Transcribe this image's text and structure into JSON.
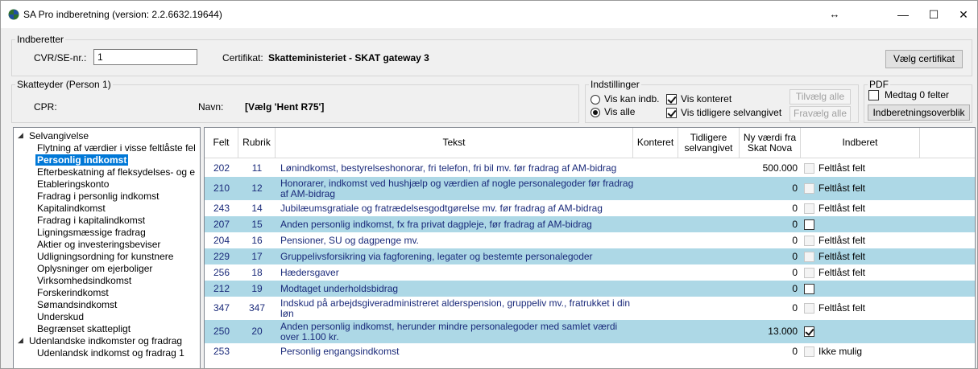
{
  "window": {
    "title": "SA Pro indberetning (version: 2.2.6632.19644)",
    "controls": {
      "resize": "↔",
      "minimize": "—",
      "maximize": "☐",
      "close": "✕"
    }
  },
  "indberetter": {
    "group_title": "Indberetter",
    "cvr_label": "CVR/SE-nr.:",
    "cvr_value": "1",
    "cert_label": "Certifikat:",
    "cert_value": "Skatteministeriet - SKAT gateway 3",
    "choose_cert_button": "Vælg certifikat"
  },
  "skatteyder": {
    "group_title": "Skatteyder (Person 1)",
    "cpr_label": "CPR:",
    "cpr_value": "",
    "navn_label": "Navn:",
    "navn_value": "[Vælg 'Hent R75']"
  },
  "indstillinger": {
    "group_title": "Indstillinger",
    "radio_vis_kan": "Vis kan indb.",
    "radio_vis_alle": "Vis alle",
    "cb_vis_konteret": "Vis konteret",
    "cb_vis_tidligere": "Vis tidligere selvangivet",
    "tilvaelg_alle": "Tilvælg alle",
    "fravaelg_alle": "Fravælg alle"
  },
  "pdf": {
    "group_title": "PDF",
    "medtag_label": "Medtag 0 felter",
    "overblik_button": "Indberetningsoverblik"
  },
  "tree": {
    "root1": "Selvangivelse",
    "items": [
      "Flytning af værdier i visse feltlåste fel",
      "Personlig indkomst",
      "Efterbeskatning af fleksydelses- og e",
      "Etableringskonto",
      "Fradrag i personlig indkomst",
      "Kapitalindkomst",
      "Fradrag i kapitalindkomst",
      "Ligningsmæssige fradrag",
      "Aktier og investeringsbeviser",
      "Udligningsordning for kunstnere",
      "Oplysninger om ejerboliger",
      "Virksomhedsindkomst",
      "Forskerindkomst",
      "Sømandsindkomst",
      "Underskud",
      "Begrænset skattepligt"
    ],
    "root2": "Udenlandske indkomster og fradrag",
    "root2_items": [
      "Udenlandsk indkomst og fradrag 1"
    ]
  },
  "grid": {
    "headers": {
      "felt": "Felt",
      "rubrik": "Rubrik",
      "tekst": "Tekst",
      "konteret": "Konteret",
      "tidligere": "Tidligere selvangivet",
      "ny_vaerdi": "Ny værdi fra Skat Nova",
      "indberet": "Indberet"
    },
    "rows": [
      {
        "felt": "202",
        "rubrik": "11",
        "tekst": "Lønindkomst, bestyrelseshonorar, fri telefon, fri bil mv. før fradrag af AM-bidrag",
        "ny": "500.000",
        "checked": false,
        "disabled": true,
        "label": "Feltlåst felt"
      },
      {
        "felt": "210",
        "rubrik": "12",
        "tekst": "Honorarer, indkomst ved hushjælp og værdien af nogle personalegoder før fradrag af AM-bidrag",
        "ny": "0",
        "checked": false,
        "disabled": true,
        "label": "Feltlåst felt"
      },
      {
        "felt": "243",
        "rubrik": "14",
        "tekst": "Jubilæumsgratiale og fratrædelsesgodtgørelse mv. før fradrag af AM-bidrag",
        "ny": "0",
        "checked": false,
        "disabled": true,
        "label": "Feltlåst felt"
      },
      {
        "felt": "207",
        "rubrik": "15",
        "tekst": "Anden personlig indkomst, fx fra privat dagpleje, før fradrag af AM-bidrag",
        "ny": "0",
        "checked": false,
        "disabled": false,
        "label": ""
      },
      {
        "felt": "204",
        "rubrik": "16",
        "tekst": "Pensioner, SU og dagpenge mv.",
        "ny": "0",
        "checked": false,
        "disabled": true,
        "label": "Feltlåst felt"
      },
      {
        "felt": "229",
        "rubrik": "17",
        "tekst": "Gruppelivsforsikring via fagforening, legater og bestemte personalegoder",
        "ny": "0",
        "checked": false,
        "disabled": true,
        "label": "Feltlåst felt"
      },
      {
        "felt": "256",
        "rubrik": "18",
        "tekst": "Hædersgaver",
        "ny": "0",
        "checked": false,
        "disabled": true,
        "label": "Feltlåst felt"
      },
      {
        "felt": "212",
        "rubrik": "19",
        "tekst": "Modtaget underholdsbidrag",
        "ny": "0",
        "checked": false,
        "disabled": false,
        "label": ""
      },
      {
        "felt": "347",
        "rubrik": "347",
        "tekst": "Indskud på arbejdsgiveradministreret alderspension, gruppeliv mv., fratrukket i din løn",
        "ny": "0",
        "checked": false,
        "disabled": true,
        "label": "Feltlåst felt"
      },
      {
        "felt": "250",
        "rubrik": "20",
        "tekst": "Anden personlig indkomst, herunder mindre personalegoder med samlet værdi over 1.100 kr.",
        "ny": "13.000",
        "checked": true,
        "disabled": false,
        "label": ""
      },
      {
        "felt": "253",
        "rubrik": "",
        "tekst": "Personlig engangsindkomst",
        "ny": "0",
        "checked": false,
        "disabled": true,
        "label": "Ikke mulig"
      }
    ]
  }
}
